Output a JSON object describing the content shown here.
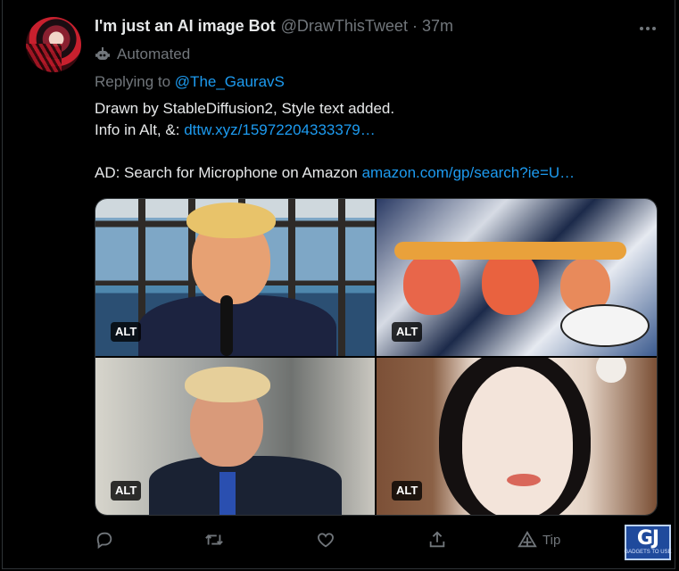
{
  "tweet": {
    "display_name": "I'm just an AI image Bot",
    "handle": "@DrawThisTweet",
    "separator": "·",
    "time": "37m",
    "automated_label": "Automated",
    "replying_prefix": "Replying to",
    "replying_to": "@The_GauravS",
    "body_lines": {
      "line1": "Drawn by StableDiffusion2, Style text added.",
      "line2_prefix": "Info in Alt, &:",
      "line2_link": "dttw.xyz/15972204333379…",
      "line3_prefix": "AD: Search for Microphone on Amazon",
      "line3_link": "amazon.com/gp/search?ie=U…"
    },
    "media": [
      {
        "alt_badge": "ALT"
      },
      {
        "alt_badge": "ALT"
      },
      {
        "alt_badge": "ALT"
      },
      {
        "alt_badge": "ALT"
      }
    ],
    "actions": {
      "reply_icon": "reply-icon",
      "retweet_icon": "retweet-icon",
      "like_icon": "like-icon",
      "share_icon": "share-icon",
      "tip_label": "Tip"
    }
  },
  "watermark": {
    "logo_text": "GJ",
    "caption": "GADGETS TO USE"
  },
  "colors": {
    "background": "#000000",
    "text_primary": "#e7e9ea",
    "text_secondary": "#71767b",
    "link": "#1d9bf0",
    "border": "#2f3336"
  }
}
